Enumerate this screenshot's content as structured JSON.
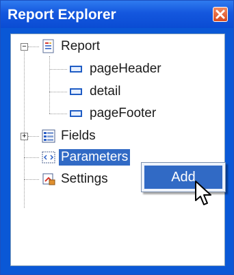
{
  "window": {
    "title": "Report Explorer"
  },
  "tree": {
    "report": {
      "label": "Report"
    },
    "sections": [
      {
        "label": "pageHeader"
      },
      {
        "label": "detail"
      },
      {
        "label": "pageFooter"
      }
    ],
    "fields": {
      "label": "Fields"
    },
    "parameters": {
      "label": "Parameters"
    },
    "settings": {
      "label": "Settings"
    }
  },
  "context_menu": {
    "items": [
      {
        "label": "Add"
      }
    ]
  },
  "colors": {
    "selection": "#316ac5",
    "title_bar": "#0a58d6",
    "close_button": "#d84a1f"
  }
}
